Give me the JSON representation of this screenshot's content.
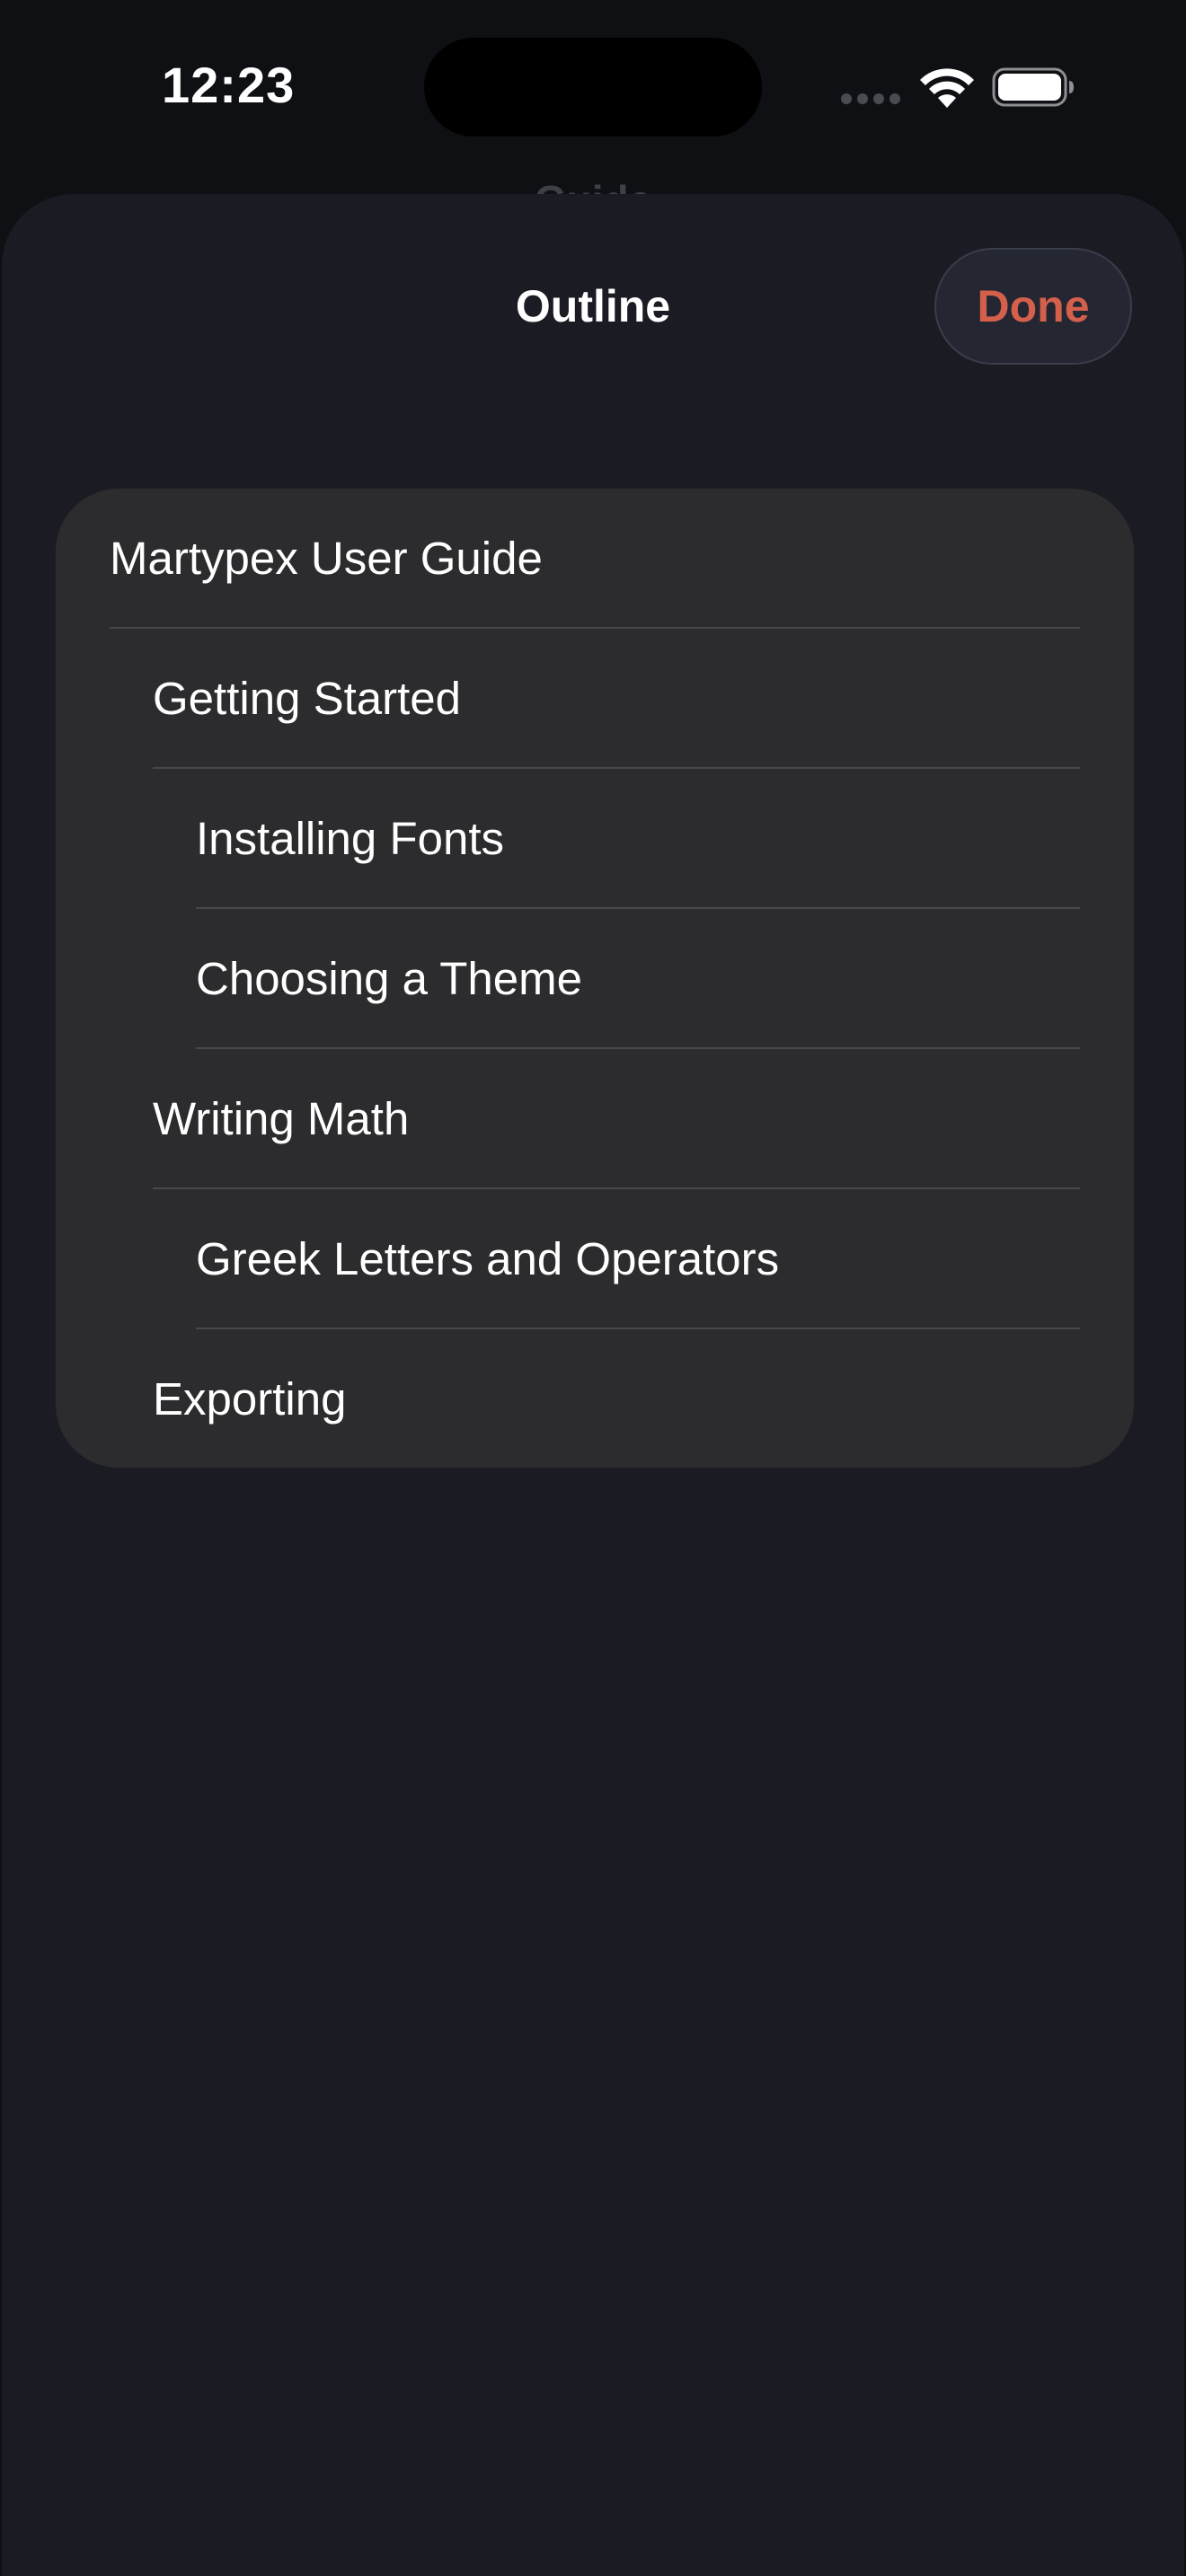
{
  "status_bar": {
    "time": "12:23"
  },
  "background": {
    "title": "Guide"
  },
  "sheet": {
    "title": "Outline",
    "done_label": "Done"
  },
  "outline": {
    "items": [
      {
        "label": "Martypex User Guide",
        "level": 0
      },
      {
        "label": "Getting Started",
        "level": 1
      },
      {
        "label": "Installing Fonts",
        "level": 2
      },
      {
        "label": "Choosing a Theme",
        "level": 2
      },
      {
        "label": "Writing Math",
        "level": 1
      },
      {
        "label": "Greek Letters and Operators",
        "level": 2
      },
      {
        "label": "Exporting",
        "level": 1
      }
    ]
  },
  "colors": {
    "sheet_background": "#1b1b24",
    "card_background": "#2c2c2e",
    "accent": "#d4604c",
    "divider": "#48484c"
  }
}
